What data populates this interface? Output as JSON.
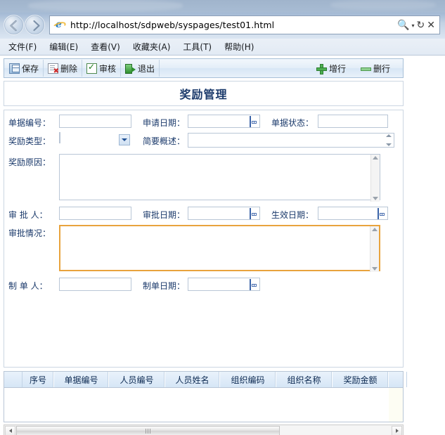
{
  "browser": {
    "url": "http://localhost/sdpweb/syspages/test01.html",
    "back_icon": "back-arrow-icon",
    "forward_icon": "forward-arrow-icon",
    "site_icon": "internet-explorer-icon",
    "search_icon": "search-magnifier-icon",
    "search_caret": "▾",
    "refresh_icon": "↻",
    "stop_icon": "✕",
    "menu": [
      {
        "label": "文件(F)",
        "name": "menu-file"
      },
      {
        "label": "编辑(E)",
        "name": "menu-edit"
      },
      {
        "label": "查看(V)",
        "name": "menu-view"
      },
      {
        "label": "收藏夹(A)",
        "name": "menu-favorites"
      },
      {
        "label": "工具(T)",
        "name": "menu-tools"
      },
      {
        "label": "帮助(H)",
        "name": "menu-help"
      }
    ]
  },
  "toolbar": {
    "left_buttons": [
      {
        "label": "保存",
        "icon": "save-icon"
      },
      {
        "label": "删除",
        "icon": "delete-icon"
      },
      {
        "label": "审核",
        "icon": "audit-check-icon"
      },
      {
        "label": "退出",
        "icon": "exit-icon"
      }
    ],
    "right_buttons": [
      {
        "label": "增行",
        "icon": "add-row-plus-icon"
      },
      {
        "label": "删行",
        "icon": "delete-row-minus-icon"
      }
    ]
  },
  "page_title": "奖励管理",
  "form": {
    "doc_no_label": "单据编号：",
    "doc_no_value": "",
    "apply_date_label": "申请日期：",
    "apply_date_value": "",
    "doc_status_label": "单据状态：",
    "doc_status_value": "",
    "award_type_label": "奖励类型：",
    "award_type_value": "",
    "brief_label": "简要概述：",
    "brief_value": "",
    "reason_label": "奖励原因：",
    "reason_value": "",
    "approver_label": "审 批 人：",
    "approver_value": "",
    "approve_date_label": "审批日期：",
    "approve_date_value": "",
    "effective_date_label": "生效日期：",
    "effective_date_value": "",
    "approval_detail_label": "审批情况：",
    "approval_detail_value": "",
    "maker_label": "制 单 人：",
    "maker_value": "",
    "make_date_label": "制单日期：",
    "make_date_value": "",
    "calendar_icon": "calendar-picker-icon",
    "dropdown_icon": "chevron-down-icon",
    "spinner_icon": "spinner-updown-icon",
    "focus_border_color": "#e8a33d"
  },
  "grid": {
    "columns": [
      "",
      "序号",
      "单据编号",
      "人员编号",
      "人员姓名",
      "组织编码",
      "组织名称",
      "奖励金额",
      ""
    ],
    "rows": []
  },
  "scrollbar": {
    "left_arrow": "scroll-left-arrow-icon",
    "right_arrow": "scroll-right-arrow-icon",
    "thumb": "horizontal-scroll-thumb"
  }
}
